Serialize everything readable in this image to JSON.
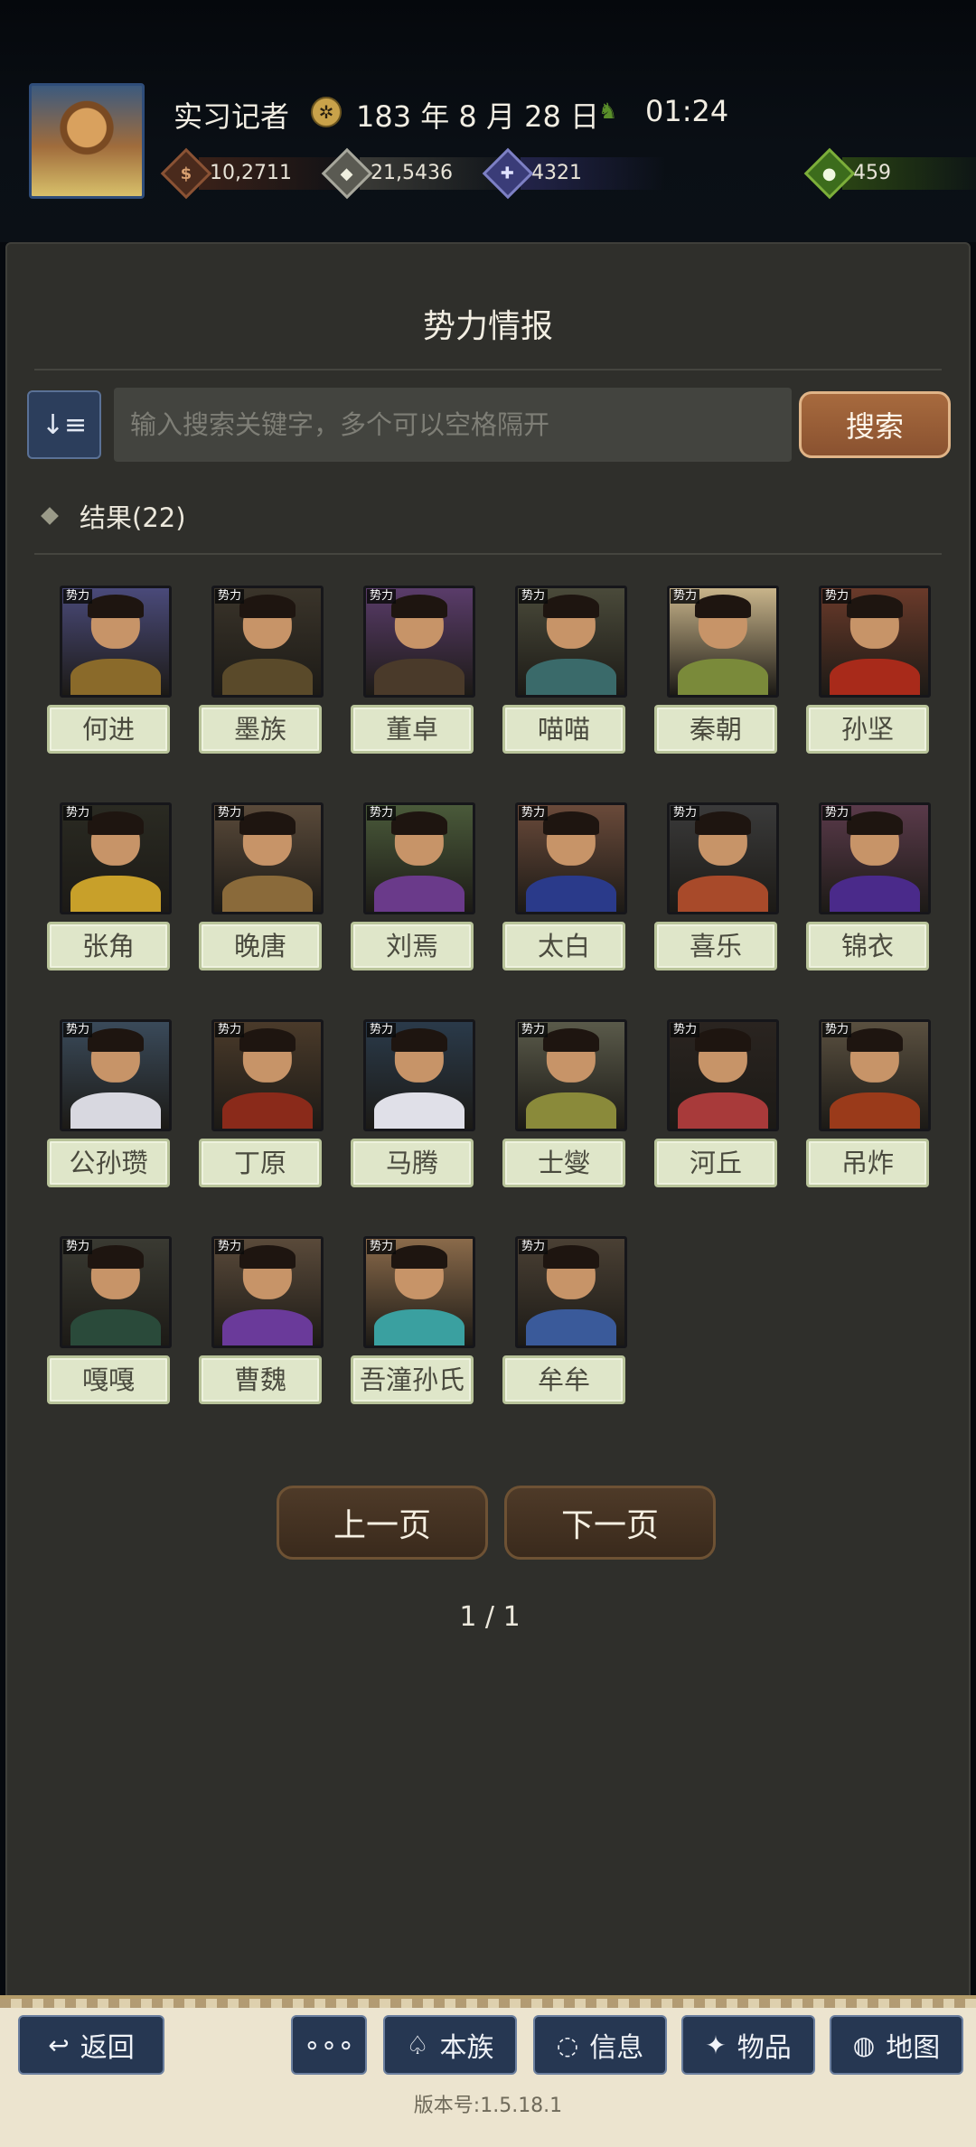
{
  "header": {
    "username": "实习记者",
    "date": "183 年 8 月 28 日",
    "time": "01:24",
    "resources": {
      "copper": "10,2711",
      "silver": "21,5436",
      "soldiers": "4321",
      "food": "459"
    }
  },
  "panel": {
    "title": "势力情报",
    "search_placeholder": "输入搜索关键字，多个可以空格隔开",
    "search_button": "搜索",
    "results_label": "结果(22)"
  },
  "faction_tag": "势力",
  "factions": [
    {
      "name": "何进",
      "robe": "#8a6a2a",
      "bg": "#4a4a7a"
    },
    {
      "name": "墨族",
      "robe": "#5a4a2a",
      "bg": "#3a342a"
    },
    {
      "name": "董卓",
      "robe": "#4a3a2a",
      "bg": "#5a3c6a"
    },
    {
      "name": "喵喵",
      "robe": "#3a6a6a",
      "bg": "#4a4a3a"
    },
    {
      "name": "秦朝",
      "robe": "#7a8a3a",
      "bg": "#c8b48a"
    },
    {
      "name": "孙坚",
      "robe": "#a82a1a",
      "bg": "#6a3a2a"
    },
    {
      "name": "张角",
      "robe": "#c8a02a",
      "bg": "#2a2a22"
    },
    {
      "name": "晚唐",
      "robe": "#8a6a3a",
      "bg": "#5a4a3a"
    },
    {
      "name": "刘焉",
      "robe": "#6a3a8a",
      "bg": "#4a5a3a"
    },
    {
      "name": "太白",
      "robe": "#2a3a8a",
      "bg": "#6a4a3a"
    },
    {
      "name": "喜乐",
      "robe": "#a84a2a",
      "bg": "#3a3a3a"
    },
    {
      "name": "锦衣",
      "robe": "#4a2a8a",
      "bg": "#5a3a4a"
    },
    {
      "name": "公孙瓒",
      "robe": "#d8d8e0",
      "bg": "#3a4a5a"
    },
    {
      "name": "丁原",
      "robe": "#8a2a1a",
      "bg": "#4a3a2a"
    },
    {
      "name": "马腾",
      "robe": "#e0e0e8",
      "bg": "#2a3a4a"
    },
    {
      "name": "士燮",
      "robe": "#8a8a3a",
      "bg": "#5a5a4a"
    },
    {
      "name": "河丘",
      "robe": "#a83a3a",
      "bg": "#2a2420"
    },
    {
      "name": "吊炸",
      "robe": "#9a3a1a",
      "bg": "#5a5040"
    },
    {
      "name": "嘎嘎",
      "robe": "#2a4a3a",
      "bg": "#3a3a32"
    },
    {
      "name": "曹魏",
      "robe": "#6a3a9a",
      "bg": "#5a4a3a"
    },
    {
      "name": "吾潼孙氏",
      "robe": "#3aa0a0",
      "bg": "#8a6a4a"
    },
    {
      "name": "牟牟",
      "robe": "#3a5a9a",
      "bg": "#4a4034"
    }
  ],
  "pagination": {
    "prev": "上一页",
    "next": "下一页",
    "page": "1 / 1"
  },
  "nav": {
    "back": "返回",
    "more": "∘∘∘",
    "clan": "本族",
    "info": "信息",
    "items": "物品",
    "map": "地图"
  },
  "version": "版本号:1.5.18.1"
}
